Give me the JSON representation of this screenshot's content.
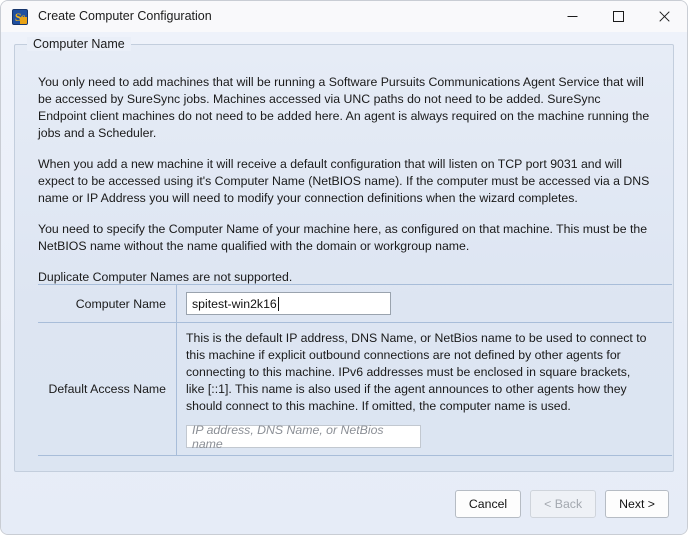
{
  "window": {
    "title": "Create Computer Configuration",
    "icon": "software-pursuits-icon",
    "icon_text": "Ss",
    "controls": {
      "minimize": "minimize-icon",
      "maximize": "maximize-icon",
      "close": "close-icon"
    },
    "colors": {
      "titlebar_bg": "#f9f9fb",
      "client_bg": "#eaeff8",
      "group_bg": "#dde5f2",
      "grid_line": "#a8bdd9",
      "icon_blue": "#1f4fa0",
      "icon_gold": "#f2b418"
    }
  },
  "groupbox": {
    "title": "Computer Name"
  },
  "intro": {
    "paragraphs": [
      "You only need to add machines that will be running a Software Pursuits Communications Agent Service that will be accessed by SureSync jobs. Machines accessed via UNC paths do not need to be added. SureSync Endpoint client machines do not need to be added here. An agent is always required on the machine running the jobs and a Scheduler.",
      "When you add a new machine it will receive a default configuration that will listen on TCP port 9031 and will expect to be accessed using it's Computer Name (NetBIOS name). If the computer must be accessed via a DNS name or IP Address you will need to modify your connection definitions when the wizard completes.",
      "You need to specify the Computer Name of your machine here, as configured on that machine. This must be the NetBIOS name without the name qualified with the domain or workgroup name.",
      "Duplicate Computer Names are not supported."
    ]
  },
  "fields": {
    "computer_name": {
      "label": "Computer Name",
      "value": "spitest-win2k16",
      "placeholder": ""
    },
    "default_access_name": {
      "label": "Default Access Name",
      "help": "This is the default IP address, DNS Name, or NetBios name to be used to connect to this machine if explicit outbound connections are not defined by other agents for connecting to this machine. IPv6 addresses must be enclosed in square brackets, like [::1]. This name is also used if the agent announces to other agents how they should connect to this machine. If omitted, the computer name is used.",
      "value": "",
      "placeholder": "IP address, DNS Name, or NetBios name"
    }
  },
  "footer": {
    "cancel_label": "Cancel",
    "back_label": "< Back",
    "next_label": "Next >",
    "back_disabled": true
  }
}
